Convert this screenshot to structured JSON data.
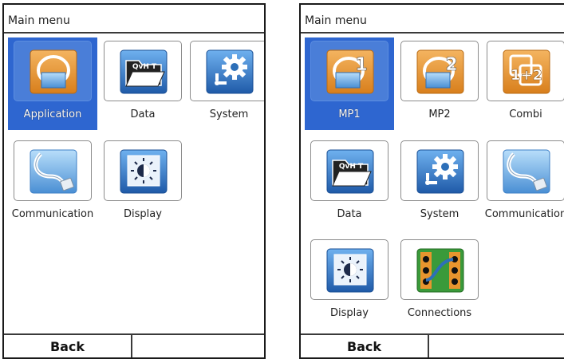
{
  "screens": [
    {
      "title": "Main menu",
      "tiles": [
        {
          "label": "Application",
          "icon": "application-icon",
          "selected": true
        },
        {
          "label": "Data",
          "icon": "data-folder-icon",
          "icon_text": "QvH T"
        },
        {
          "label": "System",
          "icon": "system-gear-icon"
        },
        {
          "label": "Communication",
          "icon": "communication-cable-icon"
        },
        {
          "label": "Display",
          "icon": "display-brightness-icon"
        }
      ],
      "softkeys": {
        "back": "Back"
      }
    },
    {
      "title": "Main menu",
      "tiles": [
        {
          "label": "MP1",
          "icon": "mp1-icon",
          "icon_text": "1",
          "selected": true
        },
        {
          "label": "MP2",
          "icon": "mp2-icon",
          "icon_text": "2"
        },
        {
          "label": "Combi",
          "icon": "combi-icon",
          "icon_text": "1+2"
        },
        {
          "label": "Data",
          "icon": "data-folder-icon",
          "icon_text": "QvH T"
        },
        {
          "label": "System",
          "icon": "system-gear-icon"
        },
        {
          "label": "Communication",
          "icon": "communication-cable-icon"
        },
        {
          "label": "Display",
          "icon": "display-brightness-icon"
        },
        {
          "label": "Connections",
          "icon": "connections-icon"
        }
      ],
      "softkeys": {
        "back": "Back"
      }
    }
  ],
  "colors": {
    "selection": "#2e66d0",
    "icon_orange": "#e8952e",
    "icon_blue": "#2d6fb8",
    "icon_green": "#3a9a3a"
  }
}
